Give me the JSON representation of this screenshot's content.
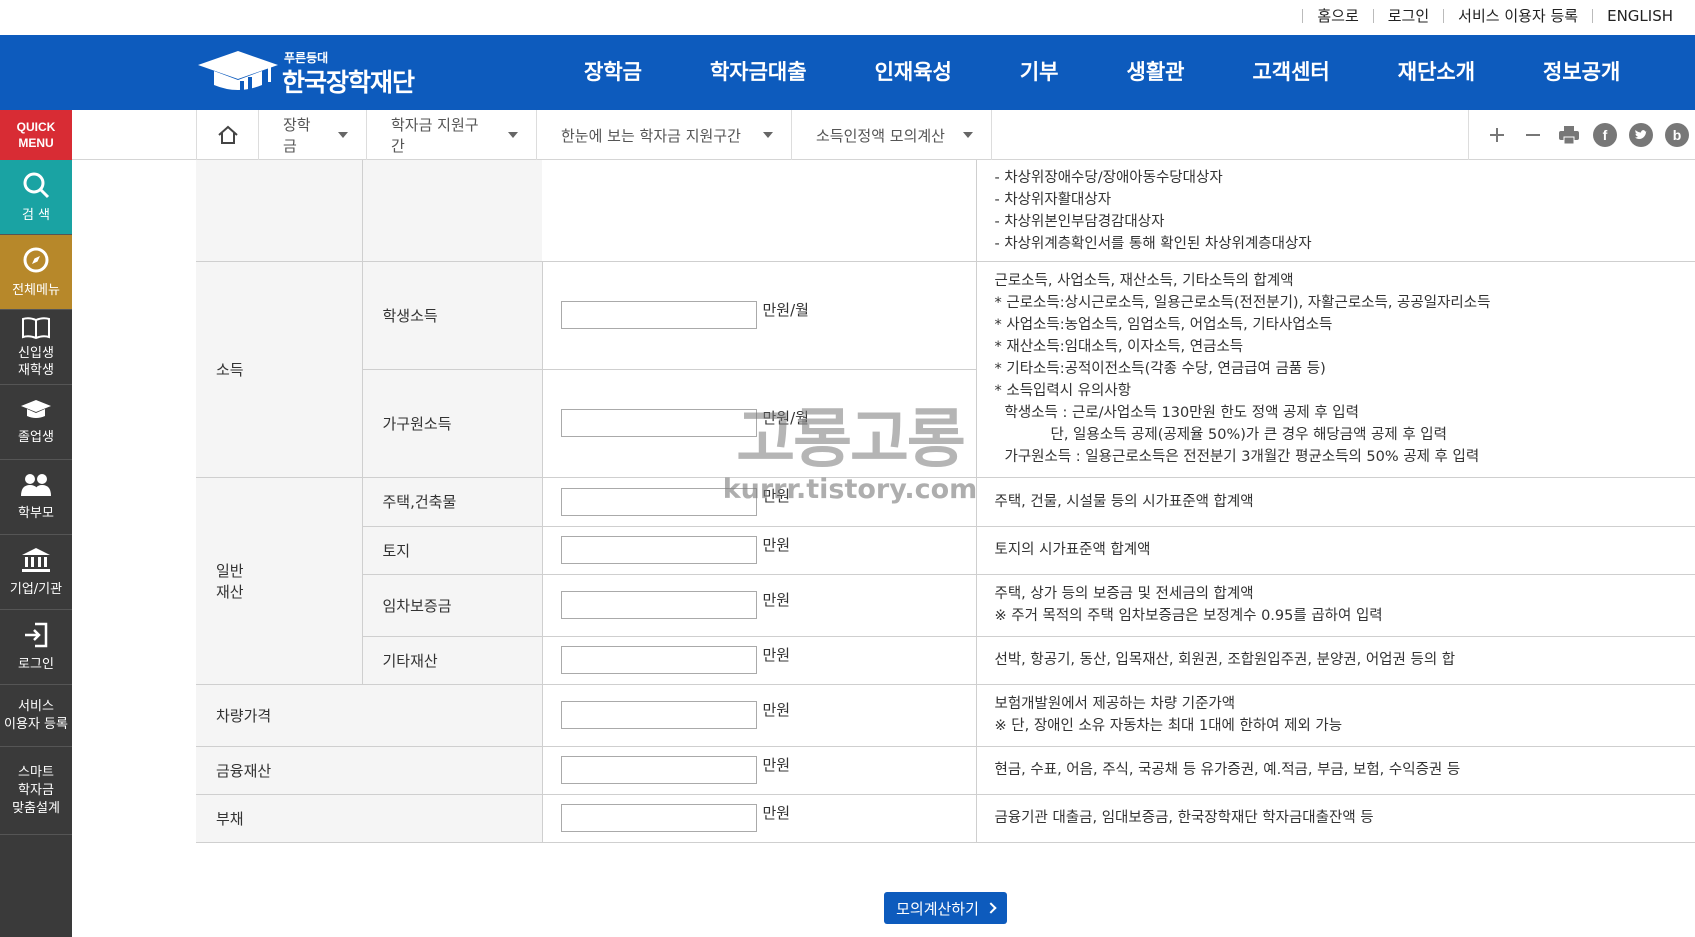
{
  "utility": [
    "홈으로",
    "로그인",
    "서비스 이용자 등록",
    "ENGLISH"
  ],
  "logo": {
    "small": "푸른등대",
    "big": "한국장학재단"
  },
  "gnb": [
    "장학금",
    "학자금대출",
    "인재육성",
    "기부",
    "생활관",
    "고객센터",
    "재단소개",
    "정보공개"
  ],
  "breadcrumb": [
    "장학금",
    "학자금 지원구간",
    "한눈에 보는 학자금 지원구간",
    "소득인정액 모의계산"
  ],
  "quick": {
    "head": [
      "QUICK",
      "MENU"
    ],
    "search": "검 색",
    "allmenu": "전체메뉴",
    "freshman": [
      "신입생",
      "재학생"
    ],
    "graduate": "졸업생",
    "parents": "학부모",
    "company": "기업/기관",
    "login": "로그인",
    "register": [
      "서비스",
      "이용자 등록"
    ],
    "smart": [
      "스마트",
      "학자금",
      "맞춤설계"
    ]
  },
  "table": {
    "top_desc": [
      "- 차상위장애수당/장애아동수당대상자",
      "- 차상위자활대상자",
      "- 차상위본인부담경감대상자",
      "- 차상위계층확인서를 통해 확인된 차상위계층대상자"
    ],
    "income": {
      "label": "소득",
      "student": "학생소득",
      "household": "가구원소득",
      "unit": "만원/월",
      "desc": [
        "근로소득, 사업소득, 재산소득, 기타소득의 합계액",
        "* 근로소득:상시근로소득, 일용근로소득(전전분기), 자활근로소득, 공공일자리소득",
        "* 사업소득:농업소득, 임업소득, 어업소득, 기타사업소득",
        "* 재산소득:임대소득, 이자소득, 연금소득",
        "* 기타소득:공적이전소득(각종 수당, 연금급여 금품 등)",
        "* 소득입력시 유의사항",
        "학생소득 : 근로/사업소득 130만원 한도 정액 공제 후 입력",
        "단, 일용소득 공제(공제율 50%)가 큰 경우 해당금액 공제 후 입력",
        "가구원소득 : 일용근로소득은 전전분기 3개월간 평균소득의 50% 공제 후 입력"
      ]
    },
    "property": {
      "label": [
        "일반",
        "재산"
      ],
      "rows": [
        {
          "name": "주택,건축물",
          "desc": [
            "주택, 건물, 시설물 등의 시가표준액 합계액"
          ]
        },
        {
          "name": "토지",
          "desc": [
            "토지의 시가표준액 합계액"
          ]
        },
        {
          "name": "임차보증금",
          "desc": [
            "주택, 상가 등의 보증금 및 전세금의 합계액",
            "※ 주거 목적의 주택 임차보증금은 보정계수 0.95를 곱하여 입력"
          ]
        },
        {
          "name": "기타재산",
          "desc": [
            "선박, 항공기, 동산, 입목재산, 회원권, 조합원입주권, 분양권, 어업권 등의 합"
          ]
        }
      ]
    },
    "vehicle": {
      "name": "차량가격",
      "desc": [
        "보험개발원에서 제공하는 차량 기준가액",
        "※ 단, 장애인 소유 자동차는 최대 1대에 한하여 제외 가능"
      ]
    },
    "finance": {
      "name": "금융재산",
      "desc": [
        "현금, 수표, 어음, 주식, 국공채 등 유가증권, 예.적금, 부금, 보험, 수익증권 등"
      ]
    },
    "debt": {
      "name": "부채",
      "desc": [
        "금융기관 대출금, 임대보증금, 한국장학재단 학자금대출잔액 등"
      ]
    },
    "unit": "만원"
  },
  "watermark": {
    "line1": "고롱고롱",
    "line2": "kurrr.tistory.com"
  },
  "button": "모의계산하기"
}
